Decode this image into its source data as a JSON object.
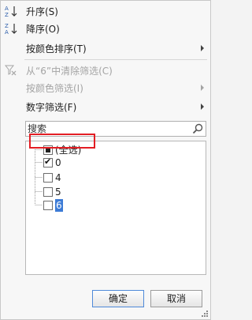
{
  "menu": {
    "sort_asc": "升序(S)",
    "sort_desc": "降序(O)",
    "sort_by_color": "按颜色排序(T)",
    "clear_filter": "从“6”中清除筛选(C)",
    "filter_by_color": "按颜色筛选(I)",
    "number_filters": "数字筛选(F)"
  },
  "sort_icon_letters": {
    "top": "A",
    "bottom": "Z"
  },
  "search": {
    "placeholder": "搜索"
  },
  "filter_list": {
    "select_all": "(全选)",
    "items": [
      "0",
      "4",
      "5",
      "6"
    ],
    "states": [
      "checked",
      "unchecked",
      "unchecked",
      "unchecked"
    ],
    "select_all_state": "partial",
    "selected_item": "6"
  },
  "buttons": {
    "ok": "确定",
    "cancel": "取消"
  },
  "colors": {
    "highlight_border": "#e31e24",
    "selection": "#3c7bd6",
    "sort_arrow": "#2a5caa"
  },
  "icons": [
    "sort-ascending-icon",
    "sort-descending-icon",
    "clear-filter-icon",
    "search-icon",
    "resize-grip-icon"
  ]
}
